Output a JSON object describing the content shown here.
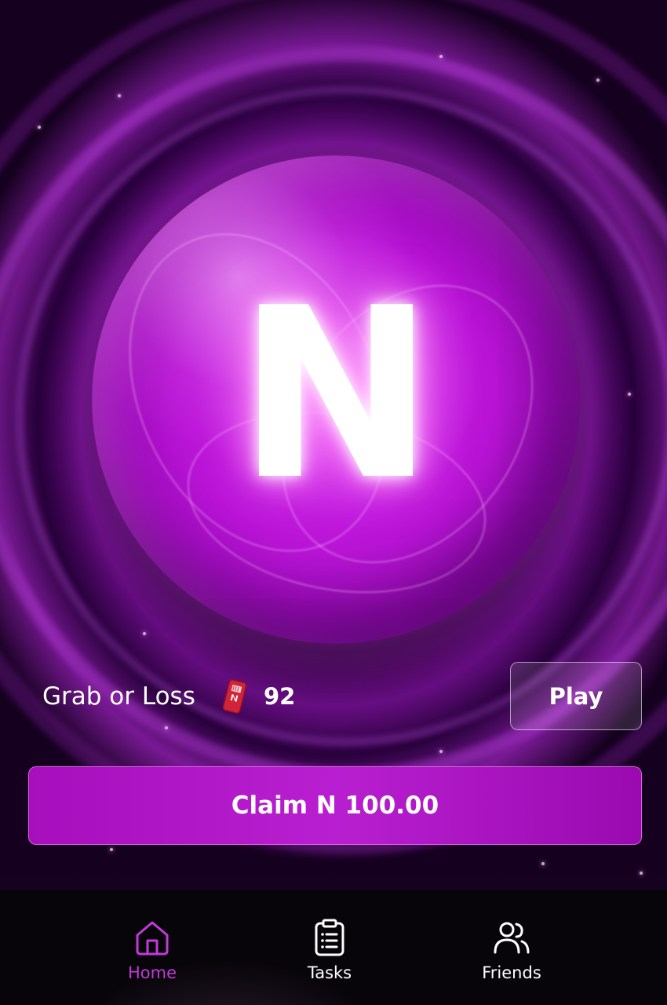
{
  "colors": {
    "accent": "#b81fd0",
    "nav_active": "#c13ad8",
    "nav_inactive": "#ffffff",
    "ticket": "#d0243a"
  },
  "orb": {
    "letter": "N",
    "icon": "n-logo-orb"
  },
  "game": {
    "title": "Grab or Loss",
    "ticket_icon": "ticket-icon",
    "ticket_count": "92",
    "play_label": "Play"
  },
  "claim": {
    "label": "Claim N 100.00"
  },
  "nav": {
    "items": [
      {
        "label": "Home",
        "icon": "home-icon",
        "active": true
      },
      {
        "label": "Tasks",
        "icon": "clipboard-icon",
        "active": false
      },
      {
        "label": "Friends",
        "icon": "users-icon",
        "active": false
      }
    ]
  }
}
